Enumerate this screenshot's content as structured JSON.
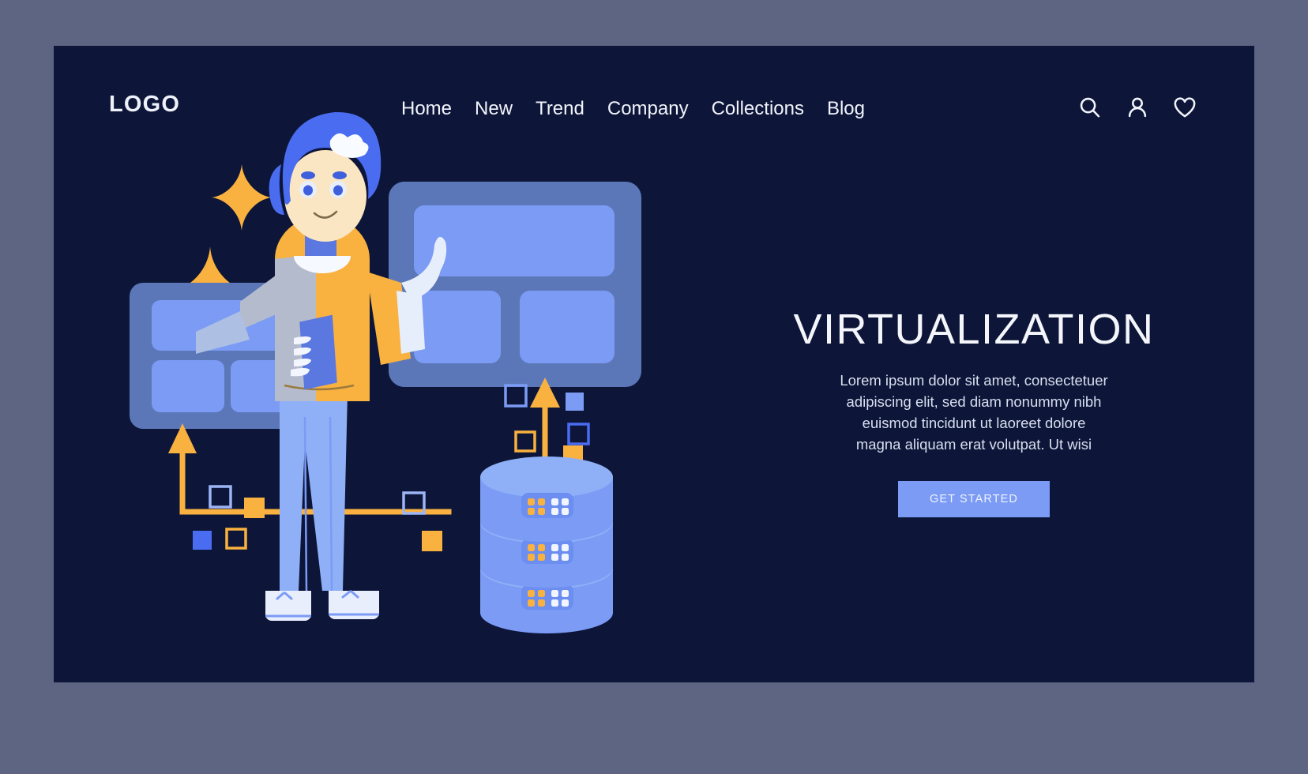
{
  "page": {
    "outer_background": "#5d6582",
    "hero_background": "#0d1638"
  },
  "header": {
    "logo": "LOGO",
    "nav": [
      {
        "label": "Home"
      },
      {
        "label": "New"
      },
      {
        "label": "Trend"
      },
      {
        "label": "Company"
      },
      {
        "label": "Collections"
      },
      {
        "label": "Blog"
      }
    ],
    "icons": [
      {
        "name": "search-icon"
      },
      {
        "name": "user-icon"
      },
      {
        "name": "heart-icon"
      }
    ]
  },
  "hero": {
    "headline": "VIRTUALIZATION",
    "paragraph_lines": [
      "Lorem ipsum dolor sit amet, consectetuer",
      "adipiscing elit, sed diam nonummy nibh",
      "euismod tincidunt ut laoreet dolore",
      "magna aliquam erat volutpat. Ut wisi"
    ],
    "cta_label": "GET STARTED"
  },
  "illustration": {
    "name": "virtualization-scene",
    "colors": {
      "panel_surface": "#5b77b8",
      "panel_tile": "#7b9bf5",
      "accent_orange": "#f9b13f",
      "character_shirt": "#f9b13f",
      "character_hair": "#4a6cf0",
      "character_pants": "#8fb0f7",
      "skin": "#fbe6c4",
      "database_body": "#8fb0f7",
      "database_band": "#6b8ef0",
      "led_orange": "#f9b13f",
      "led_white": "#f2f5ff"
    },
    "elements": [
      {
        "name": "sparkle-star-large"
      },
      {
        "name": "sparkle-star-small"
      },
      {
        "name": "vm-panel-left"
      },
      {
        "name": "vm-panel-right"
      },
      {
        "name": "character-illustration"
      },
      {
        "name": "database-stack"
      },
      {
        "name": "axis-arrow-chart"
      },
      {
        "name": "floating-squares"
      }
    ]
  }
}
